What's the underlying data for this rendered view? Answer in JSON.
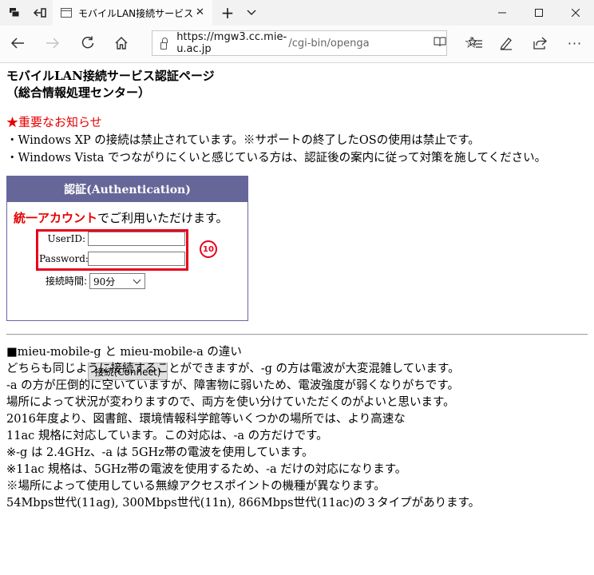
{
  "browser": {
    "tab_title": "モバイルLAN接続サービス・",
    "url_host": "https://mgw3.cc.mie-u.ac.jp",
    "url_path": "/cgi-bin/openga"
  },
  "page": {
    "title_line1": "モバイルLAN接続サービス認証ページ",
    "title_line2": "（総合情報処理センター）",
    "notice_head": "★重要なお知らせ",
    "notice_lines": [
      "・Windows XP の接続は禁止されています。※サポートの終了したOSの使用は禁止です。",
      "・Windows Vista でつながりにくいと感じている方は、認証後の案内に従って対策を施してください。"
    ]
  },
  "auth": {
    "header": "認証(Authentication)",
    "account_highlight": "統一アカウント",
    "account_suffix": "でご利用いただけます。",
    "userid_label": "UserID:",
    "password_label": "Password:",
    "userid_value": "",
    "password_value": "",
    "duration_label": "接続時間:",
    "duration_value": "90分",
    "connect_label": "接続(Connect)",
    "annotation_number": "10"
  },
  "info": {
    "lines": [
      "■mieu-mobile-g と mieu-mobile-a の違い",
      "どちらも同じように接続することができますが、-g の方は電波が大変混雑しています。",
      "-a の方が圧倒的に空いていますが、障害物に弱いため、電波強度が弱くなりがちです。",
      "場所によって状況が変わりますので、両方を使い分けていただくのがよいと思います。",
      "2016年度より、図書館、環境情報科学館等いくつかの場所では、より高速な",
      "11ac 規格に対応しています。この対応は、-a の方だけです。",
      "※-g は 2.4GHz、-a は 5GHz帯の電波を使用しています。",
      "※11ac 規格は、5GHz帯の電波を使用するため、-a だけの対応になります。",
      "※場所によって使用している無線アクセスポイントの機種が異なります。",
      "54Mbps世代(11ag), 300Mbps世代(11n), 866Mbps世代(11ac)の３タイプがあります。"
    ]
  },
  "colors": {
    "notice_red": "#e60000",
    "auth_header_bg": "#666699",
    "highlight_box": "#e8001c"
  }
}
